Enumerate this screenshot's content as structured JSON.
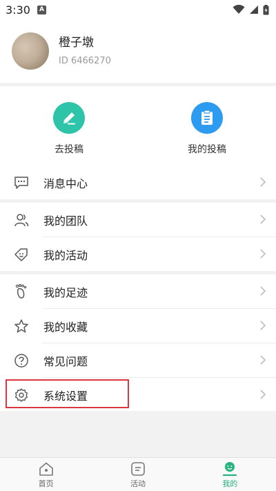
{
  "status_bar": {
    "time": "3:30",
    "app_badge": "A"
  },
  "profile": {
    "name": "橙子墩",
    "id_text": "ID 6466270"
  },
  "shortcuts": [
    {
      "label": "去投稿",
      "icon": "pencil-icon",
      "color": "#2ec4a9"
    },
    {
      "label": "我的投稿",
      "icon": "clipboard-icon",
      "color": "#2d9bf0"
    }
  ],
  "menu": {
    "message_center": "消息中心",
    "my_team": "我的团队",
    "my_activity": "我的活动",
    "my_footprint": "我的足迹",
    "my_favorites": "我的收藏",
    "faq": "常见问题",
    "settings": "系统设置"
  },
  "bottom_nav": [
    {
      "label": "首页",
      "icon": "home-icon",
      "active": false
    },
    {
      "label": "活动",
      "icon": "activity-icon",
      "active": false
    },
    {
      "label": "我的",
      "icon": "profile-smile-icon",
      "active": true
    }
  ],
  "colors": {
    "accent": "#25b37c",
    "highlight": "#d9363e"
  }
}
